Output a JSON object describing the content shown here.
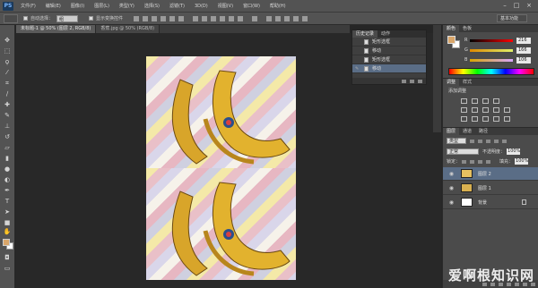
{
  "app": {
    "logo": "PS"
  },
  "menu": [
    "文件(F)",
    "编辑(E)",
    "图像(I)",
    "图层(L)",
    "类型(Y)",
    "选择(S)",
    "滤镜(T)",
    "3D(D)",
    "视图(V)",
    "窗口(W)",
    "帮助(H)"
  ],
  "window_controls": {
    "minimize": "–",
    "maximize": "□",
    "close": "×"
  },
  "options_bar": {
    "auto_select_label": "自动选择：",
    "auto_select_value": "组",
    "show_transform_label": "显示变换控件",
    "workspace": "基本功能"
  },
  "tabs": [
    {
      "label": "未标题-1 @ 50% (图层 2, RGB/8)",
      "active": true
    },
    {
      "label": "香蕉.jpg @ 50% (RGB/8)",
      "active": false
    }
  ],
  "history": {
    "tabs": [
      "历史记录",
      "动作"
    ],
    "items": [
      {
        "label": "矩形选框",
        "selected": false
      },
      {
        "label": "移动",
        "selected": false
      },
      {
        "label": "矩形选框",
        "selected": false
      },
      {
        "label": "移动",
        "selected": true
      }
    ]
  },
  "color_panel": {
    "tabs": [
      "颜色",
      "色板"
    ],
    "fg_color": "#d9a66a",
    "bg_color": "#ffffff",
    "R": "216",
    "G": "166",
    "B": "106"
  },
  "adjustments": {
    "tabs": [
      "调整",
      "样式"
    ],
    "title": "添加调整"
  },
  "layers": {
    "tabs": [
      "图层",
      "通道",
      "路径"
    ],
    "kind": "类型",
    "blend_mode": "正常",
    "opacity_label": "不透明度：",
    "opacity": "100%",
    "lock_label": "锁定：",
    "fill_label": "填充：",
    "fill": "100%",
    "items": [
      {
        "name": "图层 2",
        "selected": true
      },
      {
        "name": "图层 1",
        "selected": false
      },
      {
        "name": "背景",
        "selected": false
      }
    ]
  },
  "watermark": "爱啊根知识网"
}
